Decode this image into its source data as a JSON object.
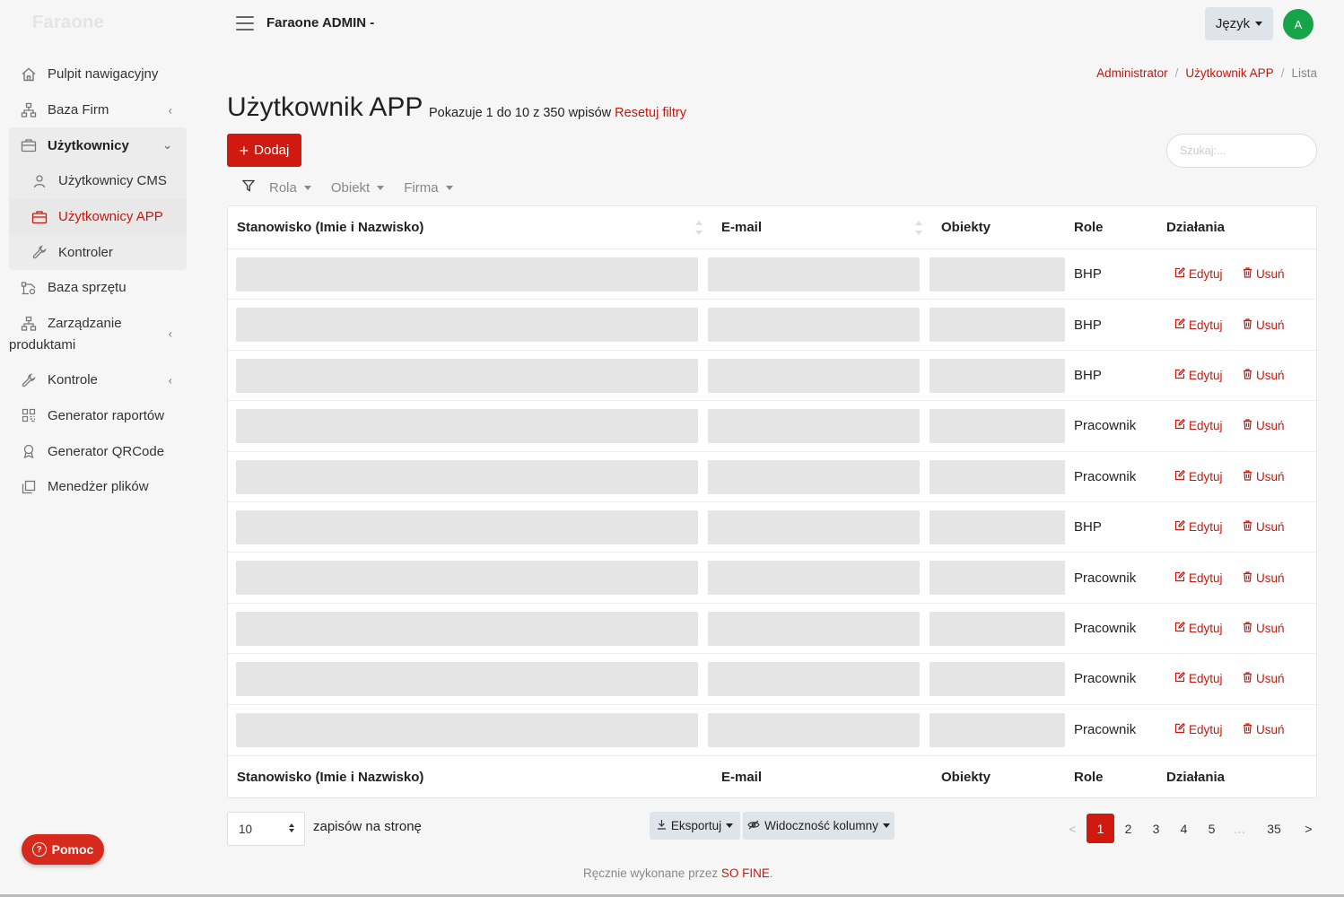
{
  "brand": "Faraone",
  "app_title": "Faraone ADMIN -",
  "language_label": "Język",
  "avatar_initial": "A",
  "sidebar": {
    "items": [
      {
        "label": "Pulpit nawigacyjny",
        "icon": "home-icon"
      },
      {
        "label": "Baza Firm",
        "icon": "sitemap-icon"
      },
      {
        "label": "Użytkownicy",
        "icon": "briefcase-icon"
      },
      {
        "label": "Użytkownicy CMS",
        "icon": "user-icon"
      },
      {
        "label": "Użytkownicy APP",
        "icon": "briefcase-icon"
      },
      {
        "label": "Kontroler",
        "icon": "wrench-icon"
      },
      {
        "label": "Baza sprzętu",
        "icon": "equipment-icon"
      },
      {
        "label": "Zarządzanie produktami",
        "icon": "sitemap-icon"
      },
      {
        "label": "Kontrole",
        "icon": "wrench-icon"
      },
      {
        "label": "Generator raportów",
        "icon": "qr-icon"
      },
      {
        "label": "Generator QRCode",
        "icon": "award-icon"
      },
      {
        "label": "Menedżer plików",
        "icon": "copy-icon"
      }
    ]
  },
  "help_label": "Pomoc",
  "breadcrumb": [
    "Administrator",
    "Użytkownik APP",
    "Lista"
  ],
  "page": {
    "title": "Użytkownik APP",
    "info": "Pokazuje 1 do 10 z 350 wpisów",
    "reset_filters": "Resetuj filtry"
  },
  "add_label": "Dodaj",
  "search_placeholder": "Szukaj:...",
  "filters": [
    "Rola",
    "Obiekt",
    "Firma"
  ],
  "table": {
    "columns": [
      "Stanowisko (Imie i Nazwisko)",
      "E-mail",
      "Obiekty",
      "Role",
      "Działania"
    ],
    "edit_label": "Edytuj",
    "delete_label": "Usuń",
    "rows": [
      {
        "role": "BHP"
      },
      {
        "role": "BHP"
      },
      {
        "role": "BHP"
      },
      {
        "role": "Pracownik"
      },
      {
        "role": "Pracownik"
      },
      {
        "role": "BHP"
      },
      {
        "role": "Pracownik"
      },
      {
        "role": "Pracownik"
      },
      {
        "role": "Pracownik"
      },
      {
        "role": "Pracownik"
      }
    ]
  },
  "per_page": {
    "value": "10",
    "label": "zapisów na stronę"
  },
  "export_label": "Eksportuj",
  "visibility_label": "Widoczność kolumny",
  "pagination": {
    "prev": "<",
    "pages": [
      "1",
      "2",
      "3",
      "4",
      "5"
    ],
    "ellipsis": "…",
    "last": "35",
    "next": ">",
    "current": "1"
  },
  "footer": {
    "text": "Ręcznie wykonane przez",
    "link": "SO FINE",
    "end": "."
  },
  "colors": {
    "accent": "#c8180e",
    "button_red": "#d0190f",
    "avatar_green": "#16a34a",
    "toolbar_grey": "#dfe3ea"
  }
}
